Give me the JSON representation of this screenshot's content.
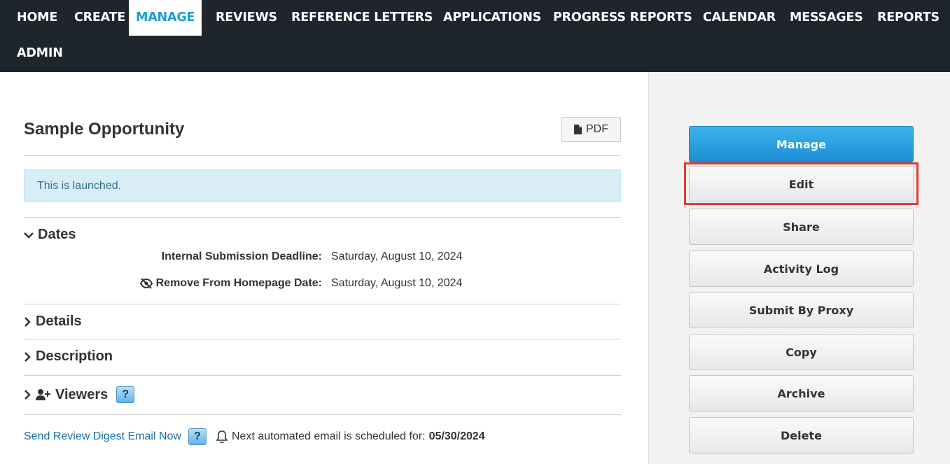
{
  "nav": {
    "items": [
      {
        "label": "HOME"
      },
      {
        "label": "CREATE"
      },
      {
        "label": "MANAGE",
        "active": true
      },
      {
        "label": "REVIEWS"
      },
      {
        "label": "REFERENCE LETTERS"
      },
      {
        "label": "APPLICATIONS"
      },
      {
        "label": "PROGRESS REPORTS"
      },
      {
        "label": "CALENDAR"
      },
      {
        "label": "MESSAGES"
      },
      {
        "label": "REPORTS"
      },
      {
        "label": "ADMIN"
      }
    ]
  },
  "page": {
    "title": "Sample Opportunity",
    "pdf_label": "PDF",
    "alert": "This is launched."
  },
  "sections": {
    "dates": {
      "title": "Dates",
      "fields": [
        {
          "label": "Internal Submission Deadline:",
          "value": "Saturday, August 10, 2024"
        },
        {
          "label": "Remove From Homepage Date:",
          "value": "Saturday, August 10, 2024",
          "icon": "eye-slash-icon"
        }
      ]
    },
    "details": {
      "title": "Details"
    },
    "description": {
      "title": "Description"
    },
    "viewers": {
      "title": "Viewers",
      "help": "?"
    }
  },
  "footer": {
    "digest_link": "Send Review Digest Email Now",
    "help": "?",
    "next_email_text": "Next automated email is scheduled for:",
    "next_email_date": "05/30/2024"
  },
  "sidebar": {
    "buttons": [
      {
        "label": "Manage"
      },
      {
        "label": "Edit"
      },
      {
        "label": "Share"
      },
      {
        "label": "Activity Log"
      },
      {
        "label": "Submit By Proxy"
      },
      {
        "label": "Copy"
      },
      {
        "label": "Archive"
      },
      {
        "label": "Delete"
      }
    ]
  },
  "colors": {
    "nav_bg": "#1e252c",
    "nav_active_text": "#1f9cd8",
    "primary_button": "#1a8fd3",
    "alert_bg": "#d9edf7",
    "highlight": "#e53935"
  }
}
